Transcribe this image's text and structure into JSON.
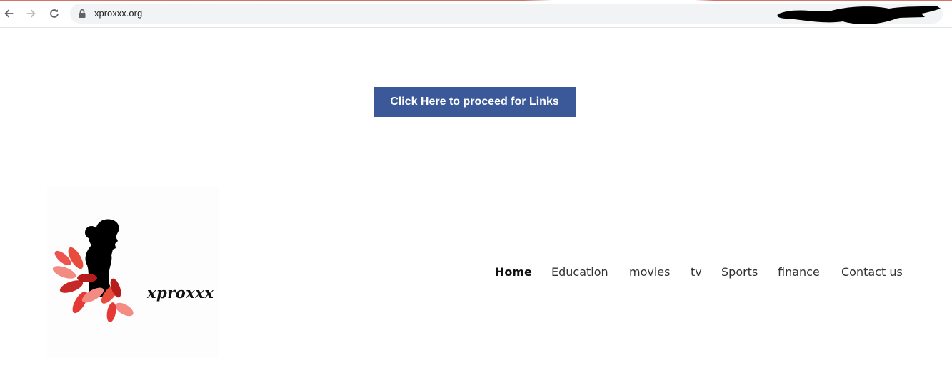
{
  "browser": {
    "url": "xproxxx.org",
    "icons": [
      "back-arrow-icon",
      "forward-arrow-icon",
      "reload-icon",
      "lock-icon"
    ]
  },
  "proceed": {
    "label": "Click Here to proceed for Links",
    "color": "#3b5998"
  },
  "logo": {
    "text": "xproxxx"
  },
  "nav": {
    "items": [
      {
        "label": "Home",
        "active": true
      },
      {
        "label": "Education",
        "active": false
      },
      {
        "label": "movies",
        "active": false
      },
      {
        "label": "tv",
        "active": false
      },
      {
        "label": "Sports",
        "active": false
      },
      {
        "label": "finance",
        "active": false
      },
      {
        "label": "Contact us",
        "active": false
      }
    ]
  }
}
